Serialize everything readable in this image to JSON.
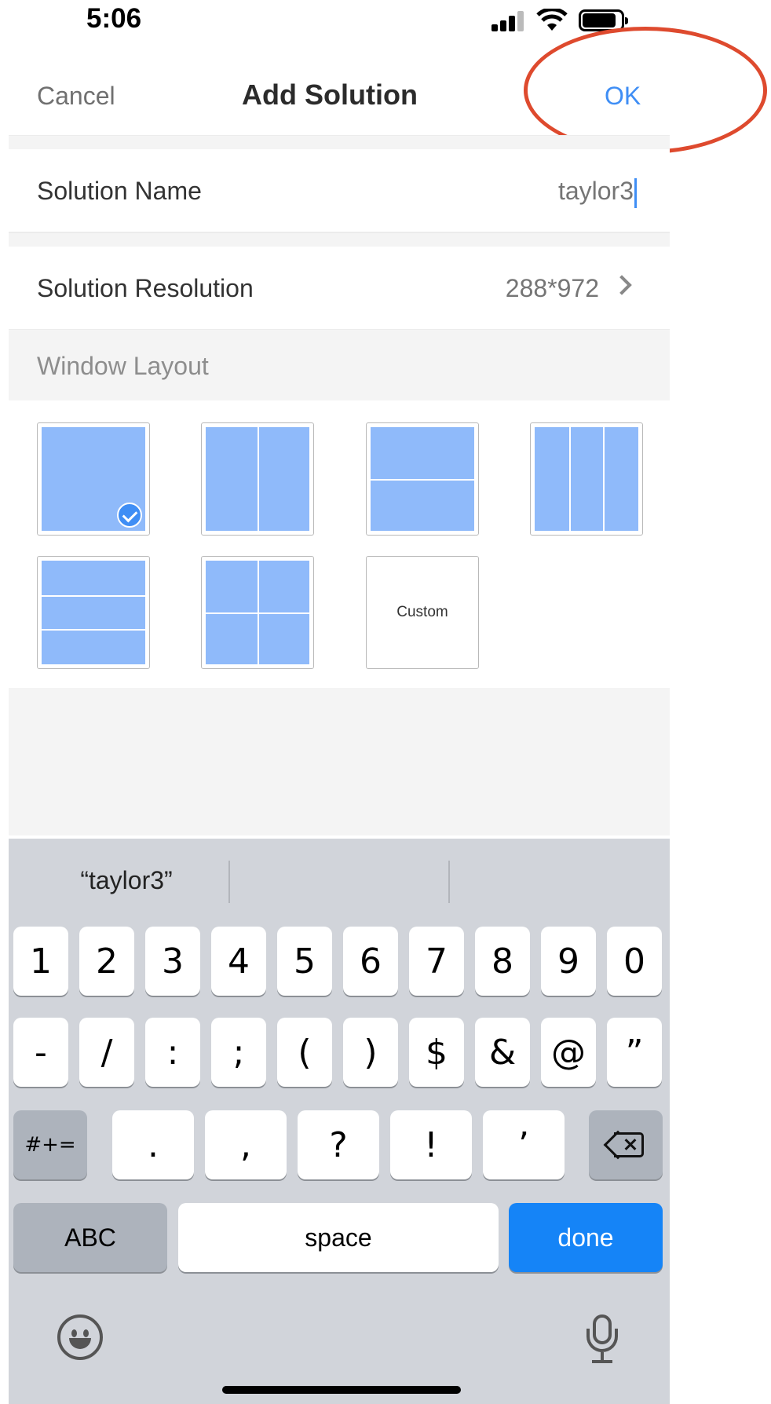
{
  "status_bar": {
    "time": "5:06"
  },
  "nav": {
    "cancel": "Cancel",
    "title": "Add Solution",
    "ok": "OK"
  },
  "form": {
    "name_label": "Solution Name",
    "name_value": "taylor3",
    "resolution_label": "Solution Resolution",
    "resolution_value": "288*972",
    "layout_header": "Window Layout"
  },
  "layouts": [
    {
      "name": "single",
      "selected": true
    },
    {
      "name": "two-columns",
      "selected": false
    },
    {
      "name": "two-rows",
      "selected": false
    },
    {
      "name": "three-columns",
      "selected": false
    },
    {
      "name": "three-rows",
      "selected": false
    },
    {
      "name": "grid-2x2",
      "selected": false
    },
    {
      "name": "custom",
      "label": "Custom",
      "selected": false
    }
  ],
  "keyboard": {
    "suggestion": "“taylor3”",
    "row1": [
      "1",
      "2",
      "3",
      "4",
      "5",
      "6",
      "7",
      "8",
      "9",
      "0"
    ],
    "row2": [
      "-",
      "/",
      ":",
      ";",
      "(",
      ")",
      "$",
      "&",
      "@",
      "”"
    ],
    "row3": [
      "#+=",
      ".",
      ",",
      "?",
      "!",
      "’"
    ],
    "abc": "ABC",
    "space": "space",
    "done": "done"
  },
  "colors": {
    "accent": "#3f8ef5",
    "annotation": "#de4a2e",
    "tile_fill": "#8fbafa",
    "done_key": "#1584f7"
  },
  "icons": [
    "signal-icon",
    "wifi-icon",
    "battery-icon",
    "chevron-right-icon",
    "check-icon",
    "backspace-icon",
    "emoji-icon",
    "microphone-icon"
  ]
}
